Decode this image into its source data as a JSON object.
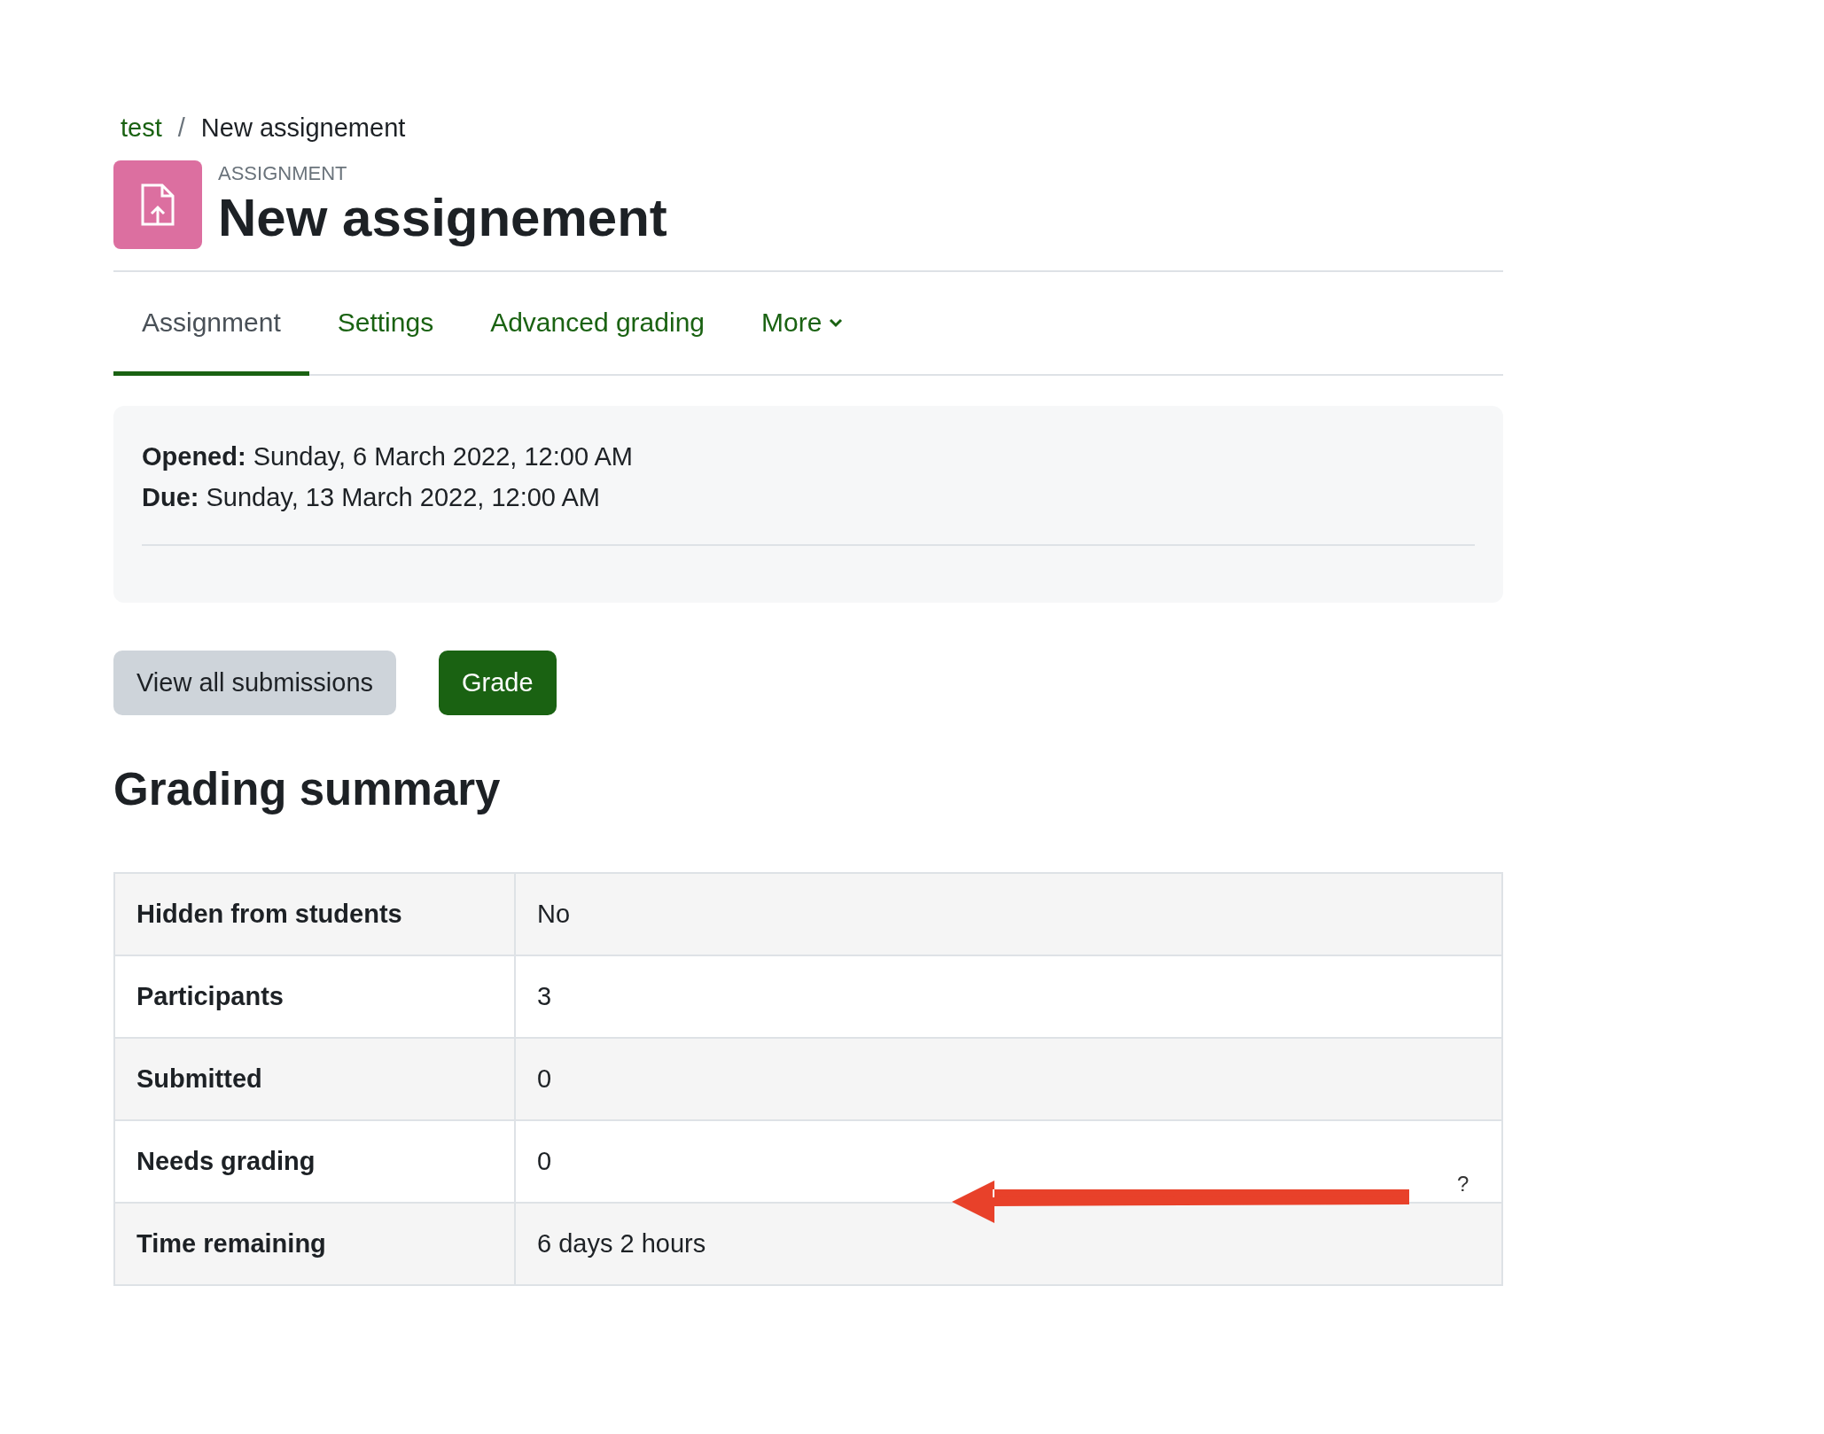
{
  "breadcrumb": [
    {
      "label": "test",
      "kind": "link"
    },
    {
      "label": "New assignement",
      "kind": "current"
    }
  ],
  "breadcrumb_separator": "/",
  "header": {
    "overline": "ASSIGNMENT",
    "title": "New assignement"
  },
  "tabs": [
    {
      "label": "Assignment",
      "selected": true,
      "dropdown": false
    },
    {
      "label": "Settings",
      "selected": false,
      "dropdown": false
    },
    {
      "label": "Advanced grading",
      "selected": false,
      "dropdown": false
    },
    {
      "label": "More",
      "selected": false,
      "dropdown": true
    }
  ],
  "dates": [
    {
      "label": "Opened:",
      "value": "Sunday, 6 March 2022, 12:00 AM"
    },
    {
      "label": "Due:",
      "value": "Sunday, 13 March 2022, 12:00 AM"
    }
  ],
  "buttons": [
    {
      "label": "View all submissions",
      "kind": "secondary"
    },
    {
      "label": "Grade",
      "kind": "primary"
    }
  ],
  "summary": {
    "heading": "Grading summary",
    "rows": [
      {
        "label": "Hidden from students",
        "value": "No"
      },
      {
        "label": "Participants",
        "value": "3"
      },
      {
        "label": "Submitted",
        "value": "0"
      },
      {
        "label": "Needs grading",
        "value": "0"
      },
      {
        "label": "Time remaining",
        "value": "6 days 2 hours"
      }
    ]
  },
  "annotation": {
    "mark": "?"
  }
}
